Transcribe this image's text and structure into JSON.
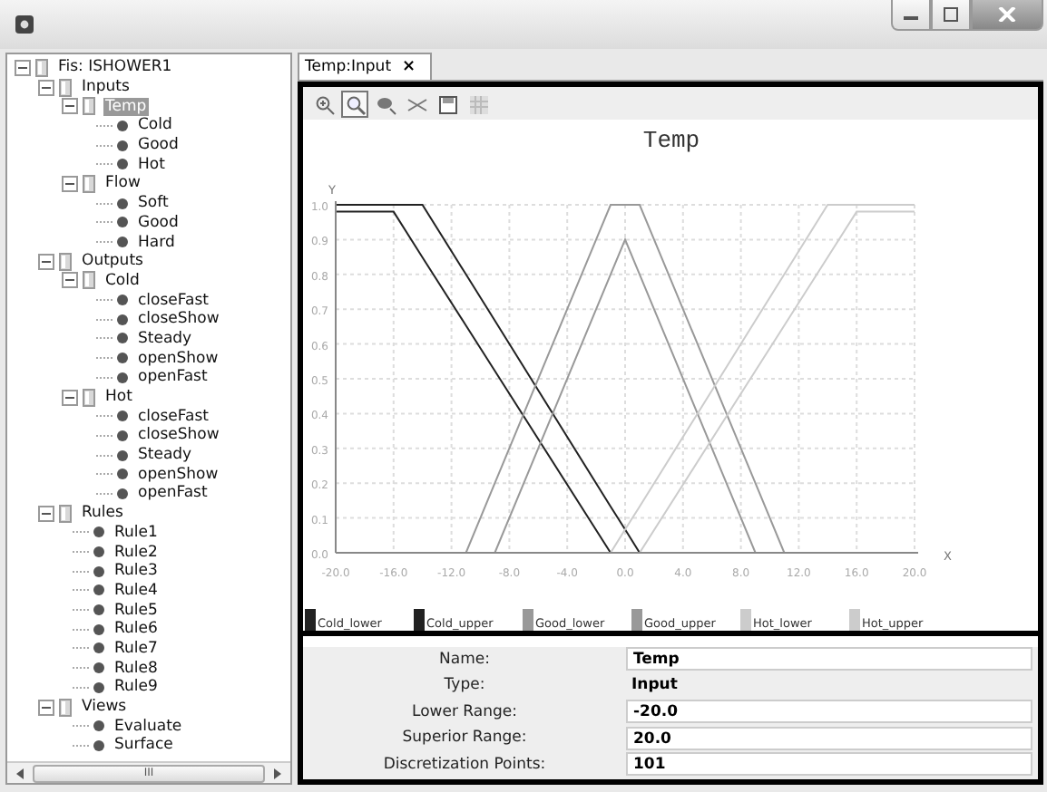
{
  "tree": [
    {
      "kind": "folder",
      "label": "Fis: ISHOWER1",
      "expanded": true,
      "selected": false,
      "children": [
        {
          "kind": "folder",
          "label": "Inputs",
          "expanded": true,
          "selected": false,
          "children": [
            {
              "kind": "folder",
              "label": "Temp",
              "expanded": true,
              "selected": true,
              "children": [
                {
                  "kind": "leaf",
                  "label": "Cold",
                  "selected": false
                },
                {
                  "kind": "leaf",
                  "label": "Good",
                  "selected": false
                },
                {
                  "kind": "leaf",
                  "label": "Hot",
                  "selected": false
                }
              ]
            },
            {
              "kind": "folder",
              "label": "Flow",
              "expanded": true,
              "selected": false,
              "children": [
                {
                  "kind": "leaf",
                  "label": "Soft",
                  "selected": false
                },
                {
                  "kind": "leaf",
                  "label": "Good",
                  "selected": false
                },
                {
                  "kind": "leaf",
                  "label": "Hard",
                  "selected": false
                }
              ]
            }
          ]
        },
        {
          "kind": "folder",
          "label": "Outputs",
          "expanded": true,
          "selected": false,
          "children": [
            {
              "kind": "folder",
              "label": "Cold",
              "expanded": true,
              "selected": false,
              "children": [
                {
                  "kind": "leaf",
                  "label": "closeFast",
                  "selected": false
                },
                {
                  "kind": "leaf",
                  "label": "closeShow",
                  "selected": false
                },
                {
                  "kind": "leaf",
                  "label": "Steady",
                  "selected": false
                },
                {
                  "kind": "leaf",
                  "label": "openShow",
                  "selected": false
                },
                {
                  "kind": "leaf",
                  "label": "openFast",
                  "selected": false
                }
              ]
            },
            {
              "kind": "folder",
              "label": "Hot",
              "expanded": true,
              "selected": false,
              "children": [
                {
                  "kind": "leaf",
                  "label": "closeFast",
                  "selected": false
                },
                {
                  "kind": "leaf",
                  "label": "closeShow",
                  "selected": false
                },
                {
                  "kind": "leaf",
                  "label": "Steady",
                  "selected": false
                },
                {
                  "kind": "leaf",
                  "label": "openShow",
                  "selected": false
                },
                {
                  "kind": "leaf",
                  "label": "openFast",
                  "selected": false
                }
              ]
            }
          ]
        },
        {
          "kind": "folder",
          "label": "Rules",
          "expanded": true,
          "selected": false,
          "children": [
            {
              "kind": "leaf",
              "label": "Rule1",
              "selected": false
            },
            {
              "kind": "leaf",
              "label": "Rule2",
              "selected": false
            },
            {
              "kind": "leaf",
              "label": "Rule3",
              "selected": false
            },
            {
              "kind": "leaf",
              "label": "Rule4",
              "selected": false
            },
            {
              "kind": "leaf",
              "label": "Rule5",
              "selected": false
            },
            {
              "kind": "leaf",
              "label": "Rule6",
              "selected": false
            },
            {
              "kind": "leaf",
              "label": "Rule7",
              "selected": false
            },
            {
              "kind": "leaf",
              "label": "Rule8",
              "selected": false
            },
            {
              "kind": "leaf",
              "label": "Rule9",
              "selected": false
            }
          ]
        },
        {
          "kind": "folder",
          "label": "Views",
          "expanded": true,
          "selected": false,
          "children": [
            {
              "kind": "leaf",
              "label": "Evaluate",
              "selected": false
            },
            {
              "kind": "leaf",
              "label": "Surface",
              "selected": false
            }
          ]
        }
      ]
    }
  ],
  "tree_scrollbar": {
    "thumb": "III"
  },
  "tabs": [
    {
      "label": "Temp:Input",
      "close": "×",
      "selected": true
    }
  ],
  "toolbar": [
    {
      "kind": "zoom-in",
      "selected": false
    },
    {
      "kind": "zoom",
      "selected": true
    },
    {
      "kind": "brush",
      "selected": false
    },
    {
      "kind": "arrows",
      "selected": false
    },
    {
      "kind": "save",
      "selected": false
    },
    {
      "kind": "grid",
      "selected": false
    }
  ],
  "chart_data": {
    "type": "line",
    "title": "Temp",
    "xlabel": "X",
    "ylabel": "Y",
    "x": [
      -20,
      -16,
      -14,
      -11,
      -9,
      -1,
      0,
      1,
      9,
      11,
      14,
      16,
      20
    ],
    "series": [
      {
        "name": "Cold_lower",
        "color": "#222222",
        "values": [
          0.98,
          0.98,
          0.849,
          0.653,
          0.523,
          0,
          0,
          0,
          0,
          0,
          0,
          0,
          0
        ]
      },
      {
        "name": "Cold_upper",
        "color": "#222222",
        "values": [
          1,
          1,
          1,
          0.8,
          0.667,
          0.133,
          0.067,
          0,
          0,
          0,
          0,
          0,
          0
        ]
      },
      {
        "name": "Good_lower",
        "color": "#999999",
        "values": [
          0,
          0,
          0,
          0,
          0,
          0.8,
          0.9,
          0.8,
          0,
          0,
          0,
          0,
          0
        ]
      },
      {
        "name": "Good_upper",
        "color": "#999999",
        "values": [
          0,
          0,
          0,
          0,
          0.2,
          1,
          1,
          1,
          0.2,
          0,
          0,
          0,
          0
        ]
      },
      {
        "name": "Hot_lower",
        "color": "#cccccc",
        "values": [
          0,
          0,
          0,
          0,
          0,
          0,
          0,
          0,
          0.523,
          0.653,
          0.849,
          0.98,
          0.98
        ]
      },
      {
        "name": "Hot_upper",
        "color": "#cccccc",
        "values": [
          0,
          0,
          0,
          0,
          0,
          0,
          0.067,
          0.133,
          0.667,
          0.8,
          1,
          1,
          1
        ]
      }
    ],
    "grid": true,
    "legend": true,
    "xlim": [
      -20,
      20
    ],
    "ylim": [
      0,
      1
    ],
    "xticks": [
      {
        "value": -20,
        "label": "-20.0"
      },
      {
        "value": -16,
        "label": "-16.0"
      },
      {
        "value": -12,
        "label": "-12.0"
      },
      {
        "value": -8,
        "label": "-8.0"
      },
      {
        "value": -4,
        "label": "-4.0"
      },
      {
        "value": 0,
        "label": "0.0"
      },
      {
        "value": 4,
        "label": "4.0"
      },
      {
        "value": 8,
        "label": "8.0"
      },
      {
        "value": 12,
        "label": "12.0"
      },
      {
        "value": 16,
        "label": "16.0"
      },
      {
        "value": 20,
        "label": "20.0"
      }
    ],
    "yticks": [
      {
        "value": 0,
        "label": "0.0"
      },
      {
        "value": 0.1,
        "label": "0.1"
      },
      {
        "value": 0.2,
        "label": "0.2"
      },
      {
        "value": 0.3,
        "label": "0.3"
      },
      {
        "value": 0.4,
        "label": "0.4"
      },
      {
        "value": 0.5,
        "label": "0.5"
      },
      {
        "value": 0.6,
        "label": "0.6"
      },
      {
        "value": 0.7,
        "label": "0.7"
      },
      {
        "value": 0.8,
        "label": "0.8"
      },
      {
        "value": 0.9,
        "label": "0.9"
      },
      {
        "value": 1,
        "label": "1.0"
      }
    ]
  },
  "properties": [
    {
      "label": "Name:",
      "value": "Temp",
      "kind": "field"
    },
    {
      "label": "Type:",
      "value": "Input",
      "kind": "text"
    },
    {
      "label": "Lower Range:",
      "value": "-20.0",
      "kind": "field"
    },
    {
      "label": "Superior Range:",
      "value": "20.0",
      "kind": "field"
    },
    {
      "label": "Discretization Points:",
      "value": "101",
      "kind": "field"
    }
  ]
}
